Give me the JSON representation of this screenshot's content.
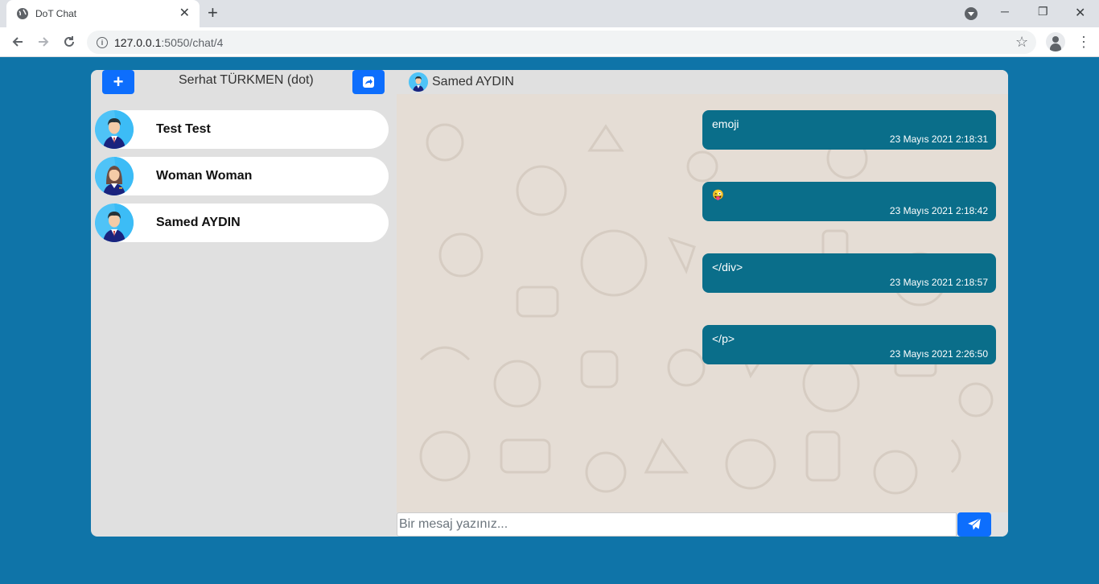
{
  "browser": {
    "tab_title": "DoT Chat",
    "url_host": "127.0.0.1",
    "url_rest": ":5050/chat/4"
  },
  "sidebar": {
    "current_user": "Serhat TÜRKMEN (dot)",
    "contacts": [
      {
        "name": "Test Test",
        "avatar": "man-avatar"
      },
      {
        "name": "Woman Woman",
        "avatar": "woman-avatar"
      },
      {
        "name": "Samed AYDIN",
        "avatar": "man-avatar"
      }
    ]
  },
  "chat": {
    "partner_name": "Samed AYDIN",
    "messages": [
      {
        "text": "emoji",
        "time": "23 Mayıs 2021 2:18:31"
      },
      {
        "text": "😜",
        "time": "23 Mayıs 2021 2:18:42"
      },
      {
        "text": "</div>",
        "time": "23 Mayıs 2021 2:18:57"
      },
      {
        "text": "</p>",
        "time": "23 Mayıs 2021 2:26:50"
      }
    ],
    "input_placeholder": "Bir mesaj yazınız..."
  },
  "colors": {
    "page_bg": "#0f74a8",
    "accent": "#0d6efd",
    "message_bubble": "#0a6e8a",
    "chat_bg": "#e5ddd5"
  }
}
